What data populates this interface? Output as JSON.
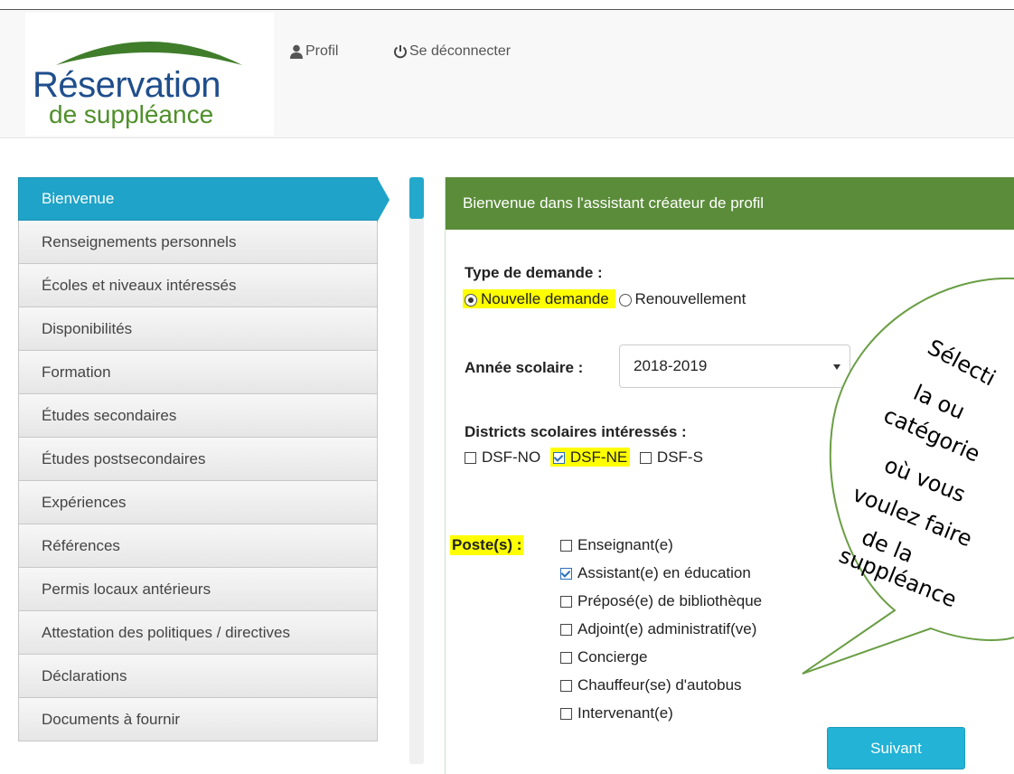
{
  "header": {
    "logo_title": "Réservation",
    "logo_subtitle": "de suppléance",
    "nav": [
      {
        "label": "Profil",
        "icon": "user-icon"
      },
      {
        "label": "Se déconnecter",
        "icon": "power-icon"
      }
    ]
  },
  "sidebar": {
    "items": [
      {
        "label": "Bienvenue",
        "active": true
      },
      {
        "label": "Renseignements personnels"
      },
      {
        "label": "Écoles et niveaux intéressés"
      },
      {
        "label": "Disponibilités"
      },
      {
        "label": "Formation"
      },
      {
        "label": "Études secondaires"
      },
      {
        "label": "Études postsecondaires"
      },
      {
        "label": "Expériences"
      },
      {
        "label": "Références"
      },
      {
        "label": "Permis locaux antérieurs"
      },
      {
        "label": "Attestation des politiques / directives"
      },
      {
        "label": "Déclarations"
      },
      {
        "label": "Documents à fournir"
      }
    ]
  },
  "panel": {
    "title": "Bienvenue dans l'assistant créateur de profil",
    "request_type": {
      "label": "Type de demande :",
      "options": [
        "Nouvelle demande",
        "Renouvellement"
      ],
      "selected": "Nouvelle demande"
    },
    "school_year": {
      "label": "Année scolaire :",
      "value": "2018-2019"
    },
    "districts": {
      "label": "Districts scolaires intéressés :",
      "options": [
        {
          "label": "DSF-NO",
          "checked": false
        },
        {
          "label": "DSF-NE",
          "checked": true
        },
        {
          "label": "DSF-S",
          "checked": false
        }
      ]
    },
    "positions": {
      "label": "Poste(s) :",
      "options": [
        {
          "label": "Enseignant(e)",
          "checked": false
        },
        {
          "label": "Assistant(e) en éducation",
          "checked": true
        },
        {
          "label": "Préposé(e) de bibliothèque",
          "checked": false
        },
        {
          "label": "Adjoint(e) administratif(ve)",
          "checked": false
        },
        {
          "label": "Concierge",
          "checked": false
        },
        {
          "label": "Chauffeur(se) d'autobus",
          "checked": false
        },
        {
          "label": "Intervenant(e)",
          "checked": false
        }
      ]
    },
    "next_button": "Suivant"
  },
  "callout": {
    "lines": [
      "Sélecti",
      "la ou",
      "catégorie",
      "où vous",
      "voulez faire",
      "de la",
      "suppléance"
    ]
  },
  "colors": {
    "accent": "#1fa3c8",
    "panel_header": "#5b8c3a",
    "highlight": "#ffff00",
    "button": "#22b3d6"
  }
}
